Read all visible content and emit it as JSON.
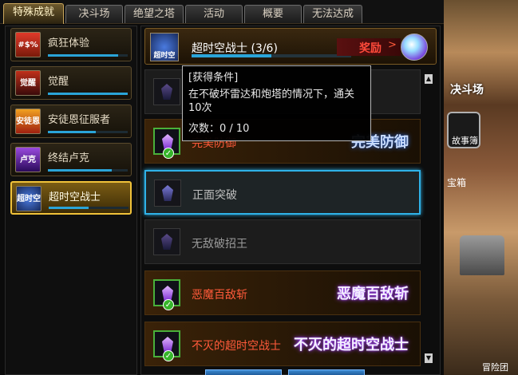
{
  "tabs": [
    {
      "label": "特殊成就",
      "active": true
    },
    {
      "label": "决斗场",
      "active": false
    },
    {
      "label": "绝望之塔",
      "active": false
    },
    {
      "label": "活动",
      "active": false
    },
    {
      "label": "概要",
      "active": false
    },
    {
      "label": "无法达成",
      "active": false
    }
  ],
  "categories": [
    {
      "label": "疯狂体验",
      "icon_text": "#$%",
      "icon_name": "crazy-experience-icon",
      "progress": 0.88
    },
    {
      "label": "觉醒",
      "icon_text": "觉醒",
      "icon_name": "awakening-icon",
      "progress": 1.0
    },
    {
      "label": "安徒恩征服者",
      "icon_text": "安徒恩",
      "icon_name": "anton-conqueror-icon",
      "progress": 0.6
    },
    {
      "label": "终结卢克",
      "icon_text": "卢克",
      "icon_name": "luke-icon",
      "progress": 0.8
    },
    {
      "label": "超时空战士",
      "icon_text": "超时空",
      "icon_name": "time-warrior-icon",
      "progress": 0.5
    }
  ],
  "header": {
    "icon_text": "超时空",
    "title": "超时空战士 (3/6)",
    "reward_label": "奖励",
    "progress": 0.5
  },
  "achievements": [
    {
      "label": "",
      "art_text": "",
      "completed": false
    },
    {
      "label": "完美防御",
      "art_text": "完美防御",
      "completed": true
    },
    {
      "label": "正面突破",
      "art_text": "",
      "completed": false
    },
    {
      "label": "无敌破招王",
      "art_text": "",
      "completed": false
    },
    {
      "label": "恶魔百敌斩",
      "art_text": "恶魔百敌斩",
      "completed": true
    },
    {
      "label": "不灭的超时空战士",
      "art_text": "不灭的超时空战士",
      "completed": true
    }
  ],
  "tooltip": {
    "title": "[获得条件]",
    "description": "在不破坏雷达和炮塔的情况下，通关10次",
    "count": "次数：0 / 10"
  },
  "scene": {
    "sign": "决斗场",
    "book_label": "故事簿",
    "box_label": "宝箱",
    "corner_label": "冒险团"
  },
  "colors": {
    "accent": "#2aa4d8",
    "active_tab": "#c9a55a",
    "completed_text": "#ff5a3a",
    "check": "#36b52a"
  }
}
